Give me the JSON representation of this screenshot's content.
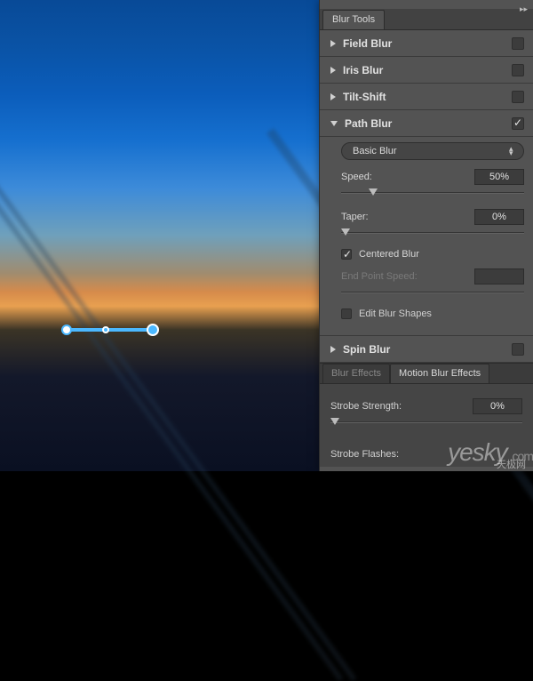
{
  "panel": {
    "tab": "Blur Tools",
    "sections": {
      "field_blur": {
        "label": "Field Blur",
        "expanded": false,
        "enabled": false
      },
      "iris_blur": {
        "label": "Iris Blur",
        "expanded": false,
        "enabled": false
      },
      "tilt_shift": {
        "label": "Tilt-Shift",
        "expanded": false,
        "enabled": false
      },
      "path_blur": {
        "label": "Path Blur",
        "expanded": true,
        "enabled": true,
        "mode": "Basic Blur",
        "speed": {
          "label": "Speed:",
          "value": "50%",
          "pos_pct": 15
        },
        "taper": {
          "label": "Taper:",
          "value": "0%",
          "pos_pct": 0
        },
        "centered_blur": {
          "label": "Centered Blur",
          "checked": true
        },
        "end_point_speed": {
          "label": "End Point Speed:",
          "value": "",
          "pos_pct": 0,
          "disabled": true
        },
        "edit_blur_shapes": {
          "label": "Edit Blur Shapes",
          "checked": false
        }
      },
      "spin_blur": {
        "label": "Spin Blur",
        "expanded": false,
        "enabled": false
      }
    }
  },
  "effects": {
    "tab_inactive": "Blur Effects",
    "tab_active": "Motion Blur Effects",
    "strobe_strength": {
      "label": "Strobe Strength:",
      "value": "0%",
      "pos_pct": 0
    },
    "strobe_flashes": {
      "label": "Strobe Flashes:"
    }
  },
  "watermark": {
    "brand": "yesky",
    "suffix": ".com",
    "sub": "天极网"
  }
}
